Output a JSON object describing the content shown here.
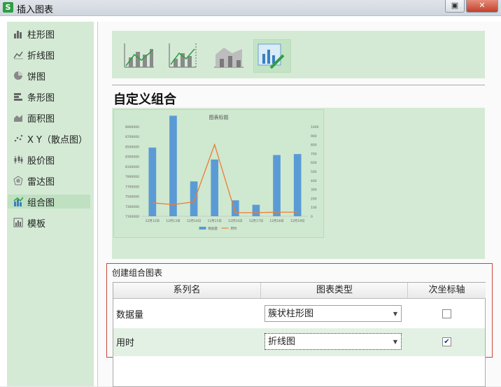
{
  "window": {
    "title": "插入图表"
  },
  "sidebar": {
    "items": [
      {
        "label": "柱形图",
        "icon": "column-chart-icon"
      },
      {
        "label": "折线图",
        "icon": "line-chart-icon"
      },
      {
        "label": "饼图",
        "icon": "pie-chart-icon"
      },
      {
        "label": "条形图",
        "icon": "bar-chart-icon"
      },
      {
        "label": "面积图",
        "icon": "area-chart-icon"
      },
      {
        "label": "X Y（散点图）",
        "icon": "scatter-chart-icon"
      },
      {
        "label": "股价图",
        "icon": "stock-chart-icon"
      },
      {
        "label": "雷达图",
        "icon": "radar-chart-icon"
      },
      {
        "label": "组合图",
        "icon": "combo-chart-icon",
        "selected": true
      },
      {
        "label": "模板",
        "icon": "template-icon"
      }
    ]
  },
  "main": {
    "section_title": "自定义组合",
    "create_label": "创建组合图表",
    "table": {
      "headers": [
        "系列名",
        "图表类型",
        "次坐标轴"
      ],
      "rows": [
        {
          "name": "数据量",
          "chart_type": "簇状柱形图",
          "secondary_axis": false
        },
        {
          "name": "用时",
          "chart_type": "折线图",
          "secondary_axis": true
        }
      ]
    }
  },
  "colors": {
    "panel_green": "#d4ead5",
    "selected_green": "#bfe0c1",
    "bar_blue": "#5b9bd5",
    "line_orange": "#ed7d31",
    "highlight_red": "#c9453b"
  },
  "chart_data": {
    "type": "bar",
    "title": "图表标题",
    "categories": [
      "12月12日",
      "12月13日",
      "12月14日",
      "12月15日",
      "12月16日",
      "12月17日",
      "12月18日",
      "12月19日"
    ],
    "series": [
      {
        "name": "数据量",
        "type": "bar",
        "axis": "primary",
        "values": [
          8480000,
          9120000,
          7800000,
          8240000,
          7420000,
          7330000,
          8330000,
          8350000
        ]
      },
      {
        "name": "用时",
        "type": "line",
        "axis": "secondary",
        "values": [
          150,
          130,
          160,
          800,
          40,
          40,
          45,
          45
        ]
      }
    ],
    "y_ticks": [
      "7100000",
      "7300000",
      "7500000",
      "7700000",
      "7900000",
      "8100000",
      "8300000",
      "8500000",
      "8700000",
      "8900000"
    ],
    "y2_ticks": [
      "0",
      "100",
      "200",
      "300",
      "400",
      "500",
      "600",
      "700",
      "800",
      "900",
      "1000"
    ],
    "ylim": [
      7100000,
      8900000
    ],
    "y2lim": [
      0,
      1000
    ],
    "legend": "bottom",
    "grid": false
  }
}
